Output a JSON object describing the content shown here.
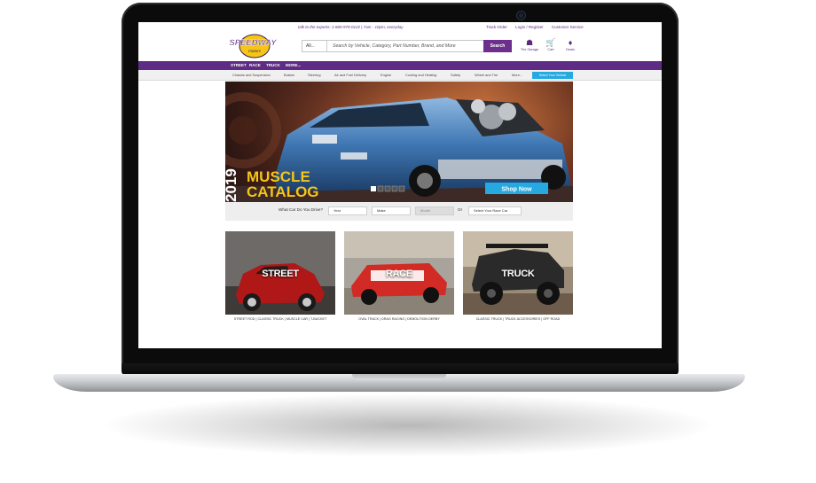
{
  "topbar": {
    "expert_text": "talk to the experts: 1-800-979-0122 | 7am - 10pm, everyday",
    "links": [
      "Track Order",
      "Login / Register",
      "Customer Service"
    ]
  },
  "header": {
    "logo_text": "SPEEDWAY",
    "logo_sub": "motors",
    "search_category": "All...",
    "search_placeholder": "Search by Vehicle, Category, Part Number, Brand, and More",
    "search_button": "Search",
    "icons": [
      {
        "icon": "garage-icon",
        "label": "The Garage"
      },
      {
        "icon": "cart-icon",
        "label": "Cart"
      },
      {
        "icon": "tag-icon",
        "label": "Deals"
      }
    ]
  },
  "nav": {
    "items": [
      "STREET",
      "RACE",
      "TRUCK",
      "MORE..."
    ]
  },
  "subnav": {
    "items": [
      "Chassis and Suspension",
      "Brakes",
      "Steering",
      "Air and Fuel Delivery",
      "Engine",
      "Cooling and Heating",
      "Safety",
      "Wheel and Tire",
      "More..."
    ],
    "vehicle_button": "Select Your Vehicle"
  },
  "hero": {
    "year": "2019",
    "title_line1": "MUSCLE",
    "title_line2": "CATALOG",
    "cta": "Shop Now",
    "slide_dots": [
      1,
      2,
      3,
      4,
      5
    ]
  },
  "vehicle_select": {
    "question": "What Car Do You Drive?",
    "year": "Year",
    "make": "Make",
    "model": "Model",
    "or": "Or",
    "race_car": "Select Your Race Car"
  },
  "categories": [
    {
      "label": "STREET",
      "links": "STREET ROD | CLASSIC TRUCK | MUSCLE CAR | T-BUCKET"
    },
    {
      "label": "RACE",
      "links": "OVAL TRACK | DRAG RACING | DEMOLITION DERBY"
    },
    {
      "label": "TRUCK",
      "links": "CLASSIC TRUCK | TRUCK ACCESSORIES | OFF ROAD"
    }
  ],
  "colors": {
    "purple": "#5e2c85",
    "accent_blue": "#26a8e0",
    "logo_yellow": "#f5c518"
  }
}
